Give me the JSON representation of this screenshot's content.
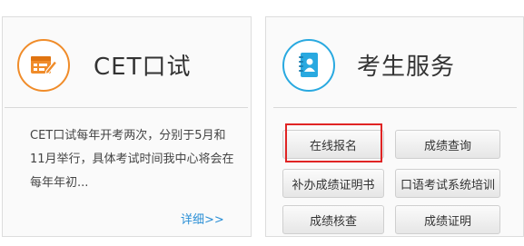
{
  "cet_card": {
    "title": "CET口试",
    "icon": "form-edit-icon",
    "description": "CET口试每年开考两次，分别于5月和11月举行，具体考试时间我中心将会在每年年初...",
    "more_link": "详细>>",
    "accent_color": "#f08c2a"
  },
  "services_card": {
    "title": "考生服务",
    "icon": "contact-book-icon",
    "accent_color": "#29a9e0",
    "buttons": [
      {
        "label": "在线报名"
      },
      {
        "label": "成绩查询"
      },
      {
        "label": "补办成绩证明书"
      },
      {
        "label": "口语考试系统培训"
      },
      {
        "label": "成绩核查"
      },
      {
        "label": "成绩证明"
      }
    ],
    "highlight_color": "#e02424"
  }
}
